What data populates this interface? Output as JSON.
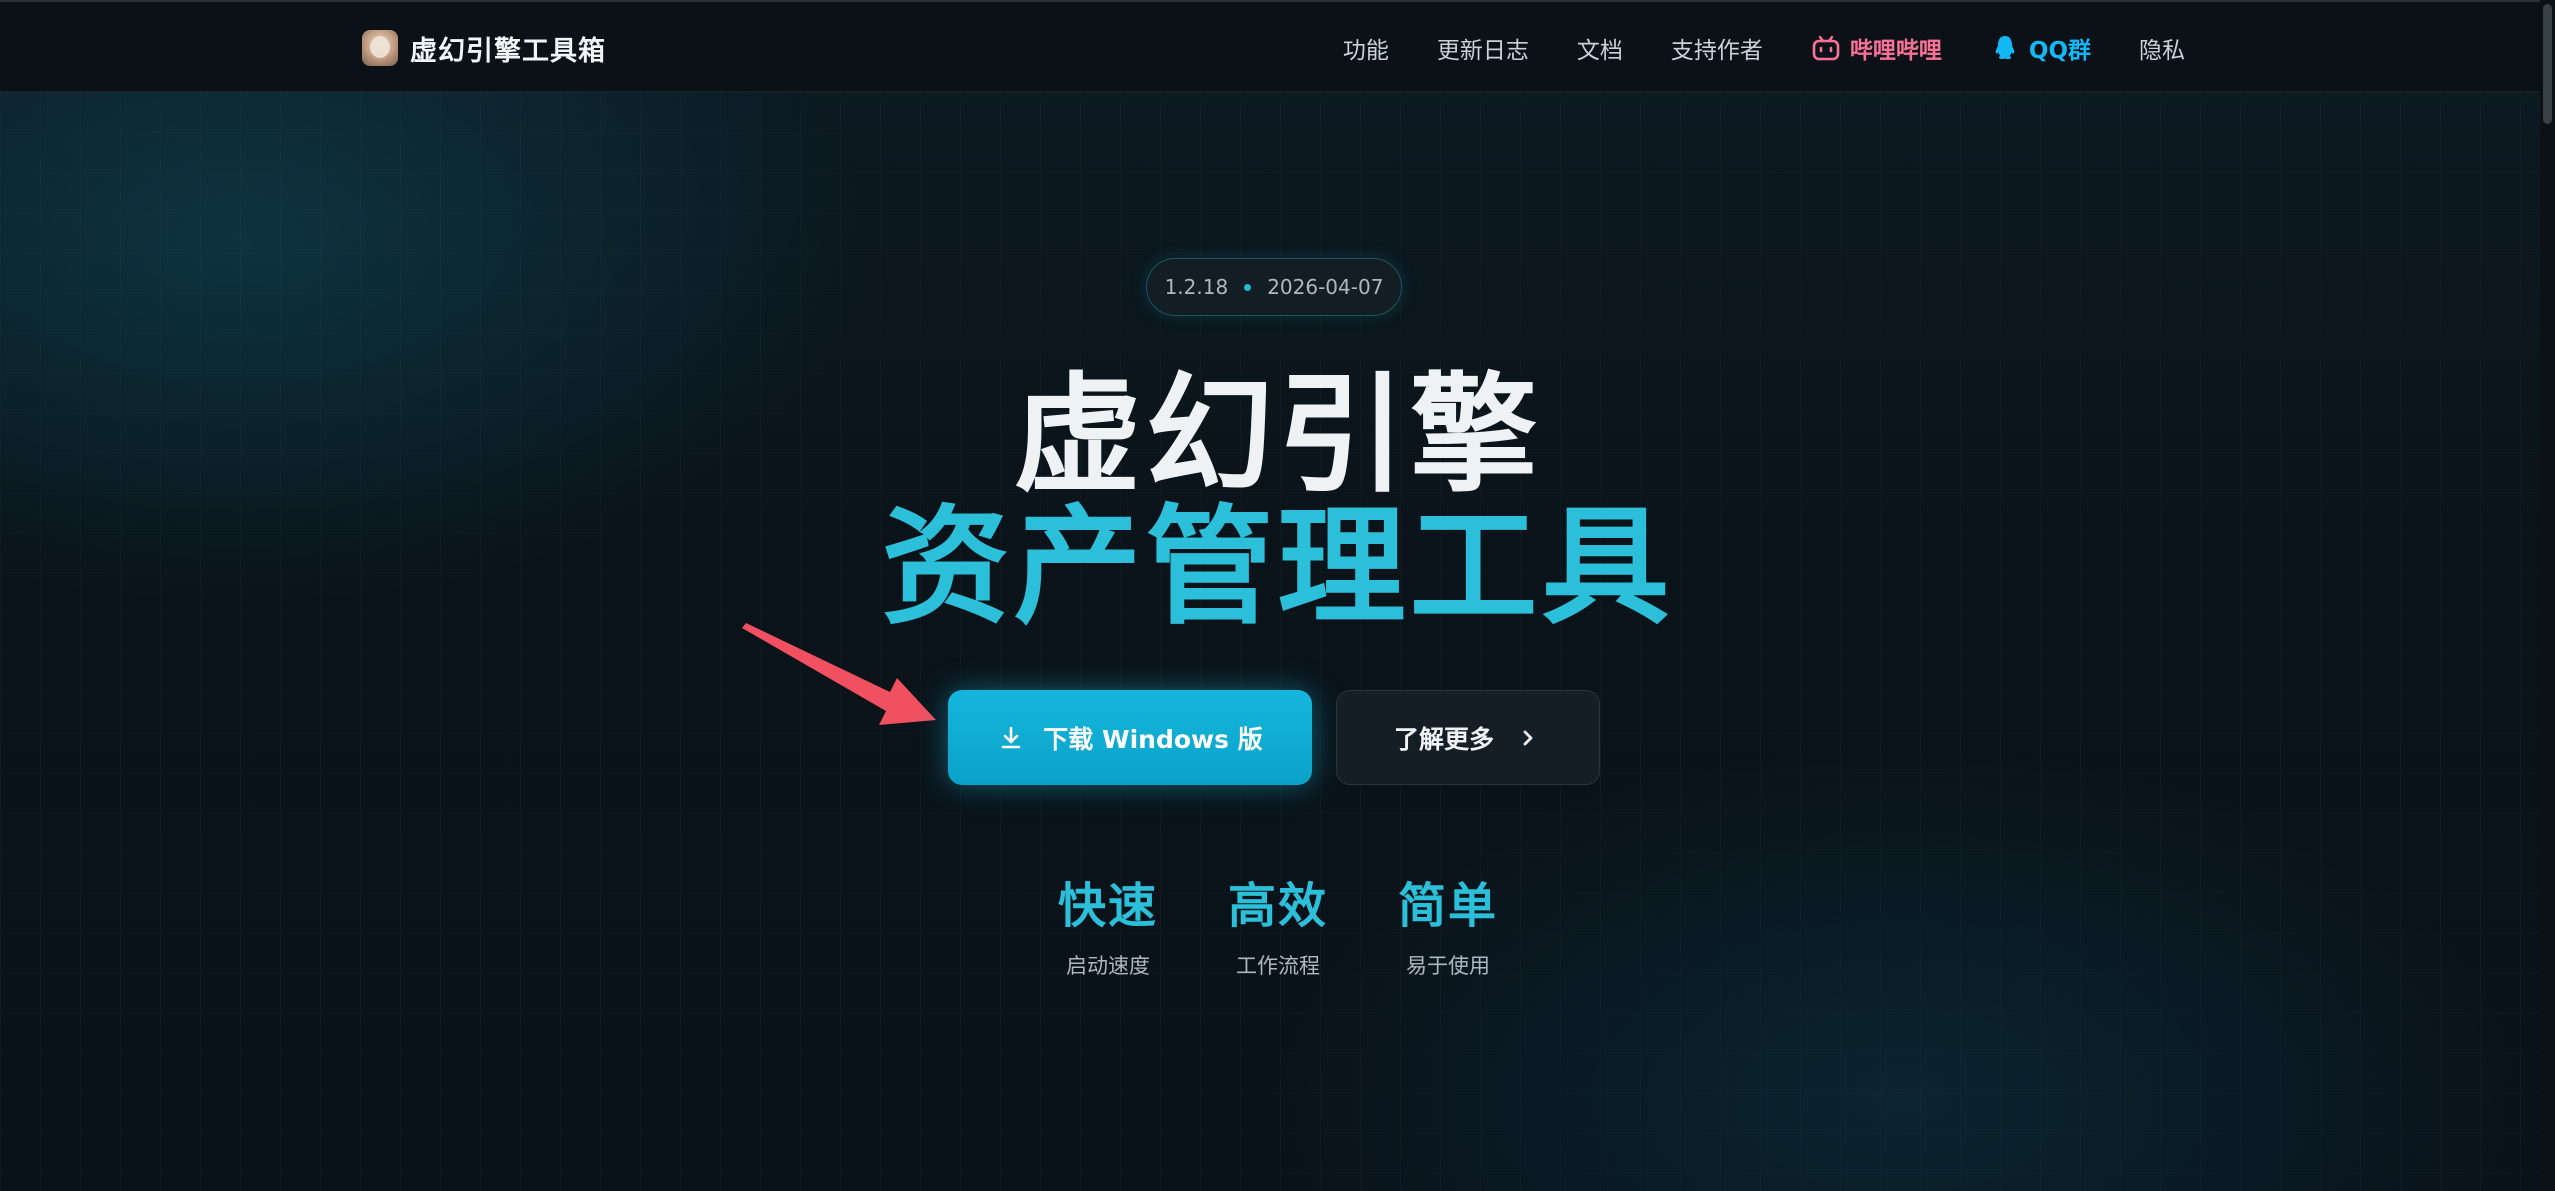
{
  "nav": {
    "brand": "虚幻引擎工具箱",
    "links": [
      {
        "label": "功能"
      },
      {
        "label": "更新日志"
      },
      {
        "label": "文档"
      },
      {
        "label": "支持作者"
      },
      {
        "label": "哔哩哔哩",
        "icon": "bilibili-icon",
        "color": "#fb7299"
      },
      {
        "label": "QQ群",
        "icon": "qq-icon",
        "color": "#12b7f5"
      },
      {
        "label": "隐私"
      }
    ]
  },
  "hero": {
    "version": "1.2.18",
    "date": "2026-04-07",
    "title_line1": "虚幻引擎",
    "title_line2": "资产管理工具",
    "primary_button": "下载 Windows 版",
    "primary_icon": "download-icon",
    "secondary_button": "了解更多",
    "secondary_icon": "chevron-right-icon",
    "annotation": "red-arrow-pointing-to-download"
  },
  "features": [
    {
      "title": "快速",
      "subtitle": "启动速度"
    },
    {
      "title": "高效",
      "subtitle": "工作流程"
    },
    {
      "title": "简单",
      "subtitle": "易于使用"
    }
  ],
  "colors": {
    "accent": "#2bbfd9",
    "button": "#0aa2c9",
    "background": "#0a1118",
    "arrow": "#f0505f"
  }
}
